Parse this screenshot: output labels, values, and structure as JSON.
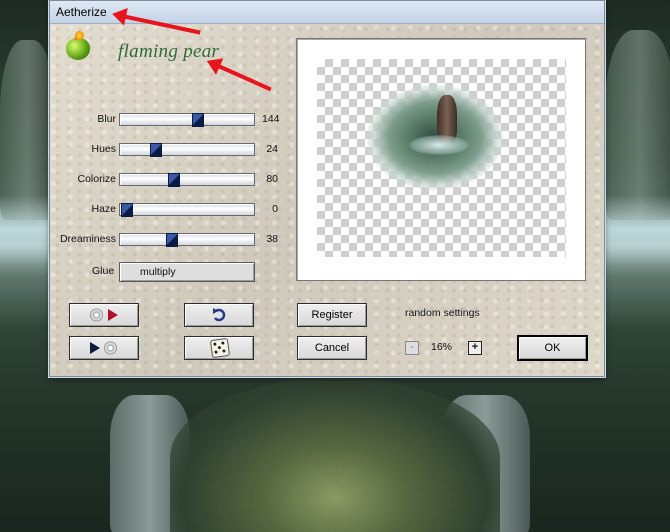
{
  "window": {
    "title": "Aetherize"
  },
  "brand": {
    "name": "flaming pear"
  },
  "sliders": [
    {
      "label": "Blur",
      "value": "144",
      "fraction": 0.62
    },
    {
      "label": "Hues",
      "value": "24",
      "fraction": 0.27
    },
    {
      "label": "Colorize",
      "value": "80",
      "fraction": 0.42
    },
    {
      "label": "Haze",
      "value": "0",
      "fraction": 0.0
    },
    {
      "label": "Dreaminess",
      "value": "38",
      "fraction": 0.4
    }
  ],
  "glue": {
    "label": "Glue",
    "value": "multiply"
  },
  "buttons": {
    "register": "Register",
    "cancel": "Cancel",
    "ok": "OK"
  },
  "random": {
    "label": "random settings"
  },
  "zoom": {
    "minus": "-",
    "value": "16%",
    "plus": "+"
  },
  "icons": {
    "load_settings": [
      "disc-icon",
      "play-red-icon"
    ],
    "save_settings": [
      "play-dark-icon",
      "disc-icon"
    ],
    "undo": "undo-icon",
    "randomize": "dice-icon"
  },
  "colors": {
    "annotation_arrow": "#e8141b",
    "brand": "#2f6a38"
  }
}
